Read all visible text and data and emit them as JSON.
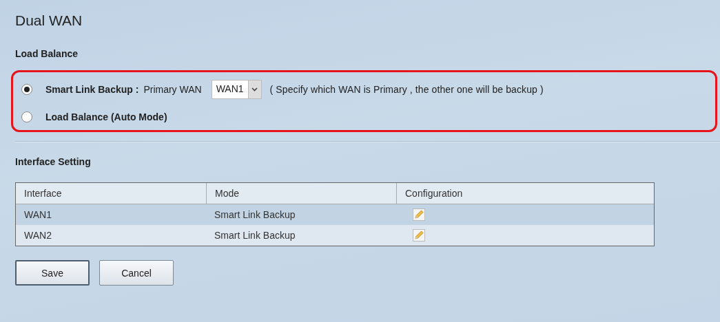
{
  "page": {
    "title": "Dual WAN"
  },
  "load_balance": {
    "heading": "Load Balance",
    "options": [
      {
        "kind": "smart",
        "label": "Smart Link Backup :",
        "selected": true,
        "field_label": "Primary WAN",
        "select_value": "WAN1",
        "hint": "( Specify which WAN is Primary , the other one will be backup )"
      },
      {
        "kind": "plain",
        "label": "Load Balance (Auto Mode)",
        "selected": false
      }
    ]
  },
  "interface_setting": {
    "heading": "Interface Setting",
    "table": {
      "columns": [
        "Interface",
        "Mode",
        "Configuration"
      ],
      "rows": [
        {
          "interface": "WAN1",
          "mode": "Smart Link Backup",
          "selected": true
        },
        {
          "interface": "WAN2",
          "mode": "Smart Link Backup",
          "selected": false
        }
      ]
    }
  },
  "buttons": [
    {
      "label": "Save",
      "focused": true
    },
    {
      "label": "Cancel",
      "focused": false
    }
  ]
}
